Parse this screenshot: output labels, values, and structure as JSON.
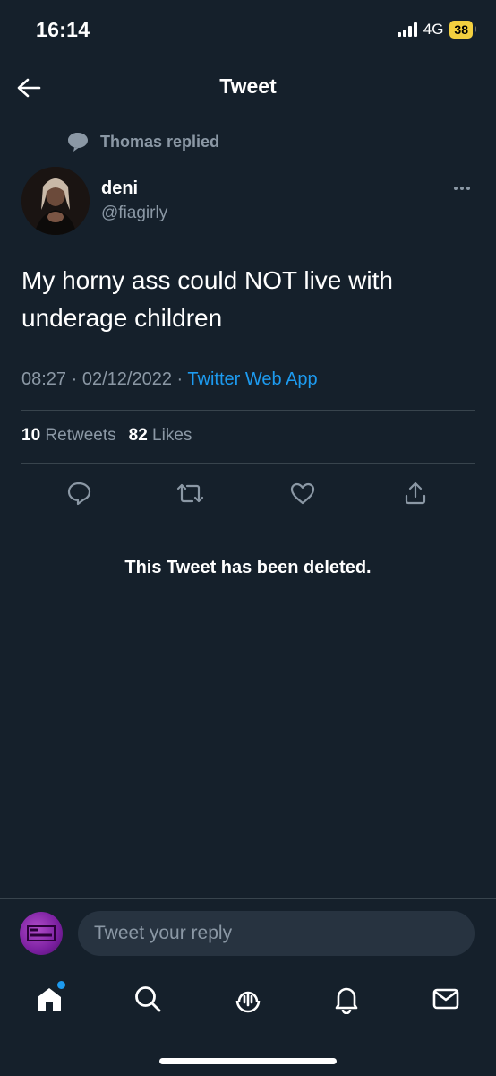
{
  "status_bar": {
    "time": "16:14",
    "network": "4G",
    "battery": "38",
    "battery_color": "#f4d03f"
  },
  "header": {
    "title": "Tweet",
    "back_icon": "arrow-left-icon"
  },
  "reply_context": {
    "icon": "speech-bubble-icon",
    "text": "Thomas replied"
  },
  "tweet": {
    "author_name": "deni",
    "author_handle": "@fiagirly",
    "text": "My horny ass could NOT live with underage children",
    "time": "08:27",
    "date": "02/12/2022",
    "separator": "·",
    "source": "Twitter Web App",
    "retweets_count": "10",
    "retweets_label": "Retweets",
    "likes_count": "82",
    "likes_label": "Likes"
  },
  "actions": [
    "reply-icon",
    "retweet-icon",
    "like-icon",
    "share-icon"
  ],
  "deleted_notice": "This Tweet has been deleted.",
  "reply_bar": {
    "placeholder": "Tweet your reply"
  },
  "tab_bar": [
    "home-icon",
    "search-icon",
    "spaces-icon",
    "notifications-icon",
    "messages-icon"
  ],
  "colors": {
    "background": "#15202b",
    "accent": "#1d9bf0",
    "secondary_text": "#8b98a5",
    "divider": "#38444d"
  }
}
